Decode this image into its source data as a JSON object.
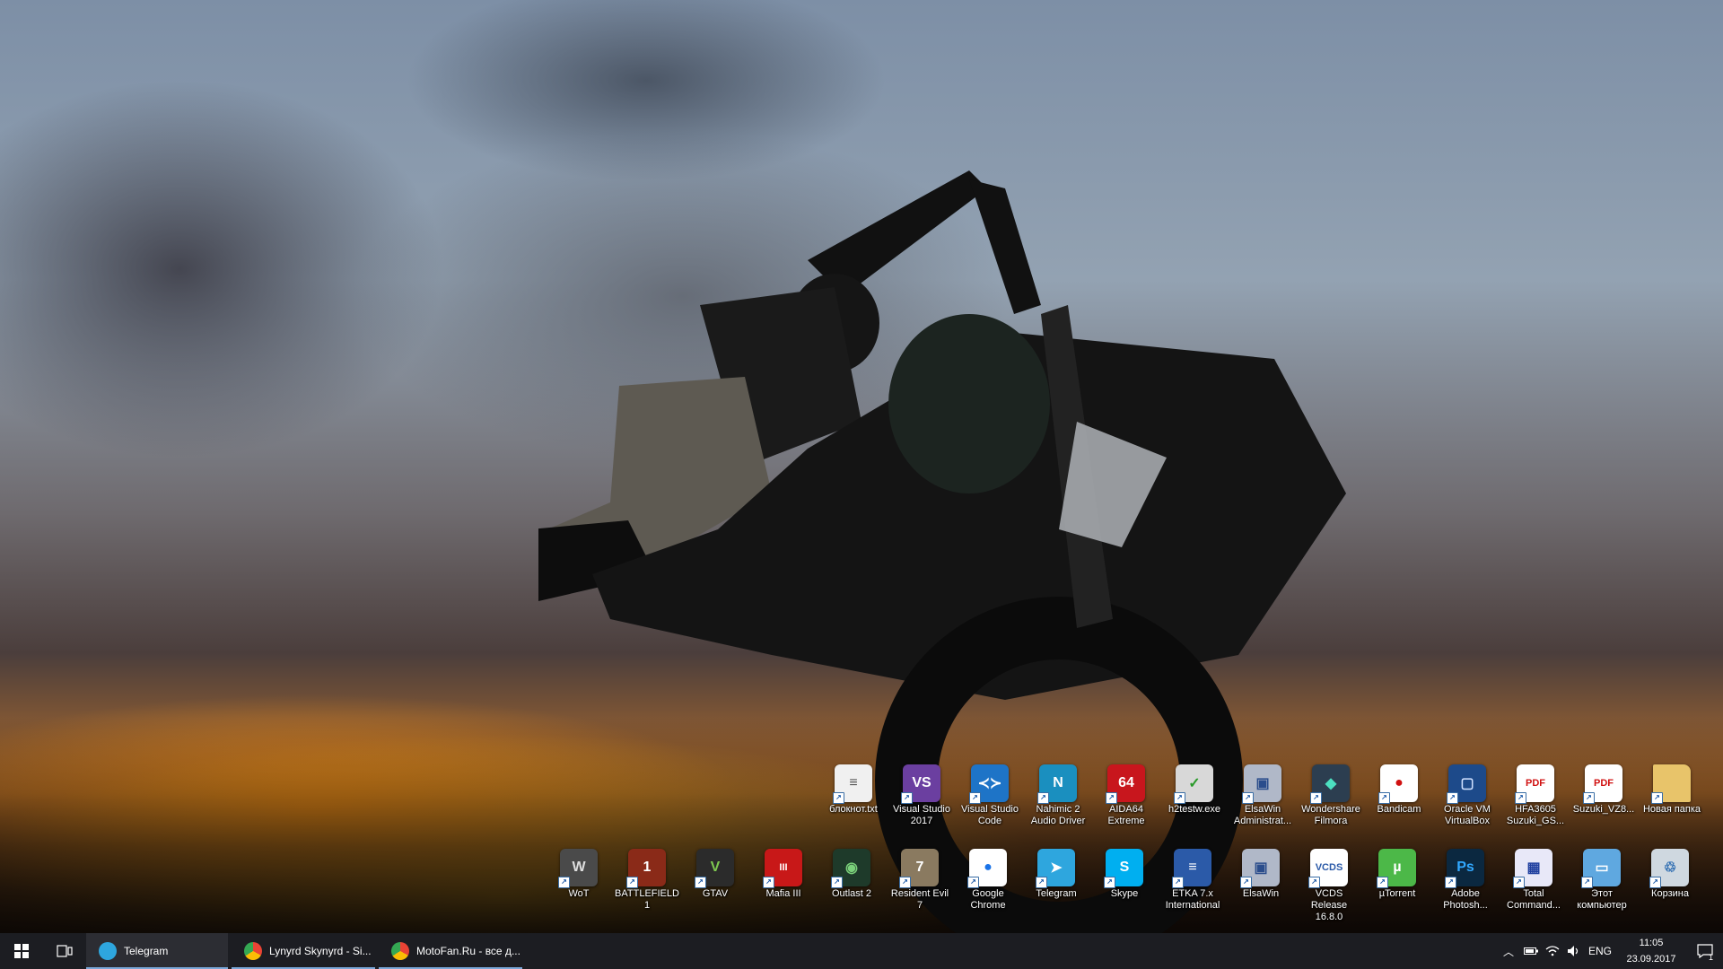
{
  "desktop_icons_row1": [
    {
      "label": "блокнот.txt",
      "icon": "text-file-icon",
      "color": "#f0f0f0",
      "glyph": "≡",
      "fg": "#555"
    },
    {
      "label": "Visual Studio 2017",
      "icon": "visual-studio-icon",
      "color": "#6b3fa0",
      "glyph": "VS",
      "fg": "#fff"
    },
    {
      "label": "Visual Studio Code",
      "icon": "vscode-icon",
      "color": "#1e74c7",
      "glyph": "≺≻",
      "fg": "#fff"
    },
    {
      "label": "Nahimic 2 Audio Driver",
      "icon": "nahimic-icon",
      "color": "#1a8fbf",
      "glyph": "N",
      "fg": "#fff"
    },
    {
      "label": "AIDA64 Extreme",
      "icon": "aida64-icon",
      "color": "#c8161d",
      "glyph": "64",
      "fg": "#fff"
    },
    {
      "label": "h2testw.exe",
      "icon": "h2testw-icon",
      "color": "#d8d8d8",
      "glyph": "✓",
      "fg": "#2a9a2a"
    },
    {
      "label": "ElsaWin Administrat...",
      "icon": "elsawin-admin-icon",
      "color": "#b0b8c8",
      "glyph": "▣",
      "fg": "#2b4d8c"
    },
    {
      "label": "Wondershare Filmora",
      "icon": "filmora-icon",
      "color": "#2c3e50",
      "glyph": "◆",
      "fg": "#4ce0c0"
    },
    {
      "label": "Bandicam",
      "icon": "bandicam-icon",
      "color": "#ffffff",
      "glyph": "●",
      "fg": "#d01010"
    },
    {
      "label": "Oracle VM VirtualBox",
      "icon": "virtualbox-icon",
      "color": "#1d4a8a",
      "glyph": "▢",
      "fg": "#cfe0ff"
    },
    {
      "label": "HFA3605 Suzuki_GS...",
      "icon": "pdf-icon",
      "color": "#ffffff",
      "glyph": "PDF",
      "fg": "#d01010"
    },
    {
      "label": "Suzuki_VZ8...",
      "icon": "pdf-icon",
      "color": "#ffffff",
      "glyph": "PDF",
      "fg": "#d01010"
    },
    {
      "label": "Новая папка",
      "icon": "folder-icon",
      "color": "#e8c46a",
      "glyph": "",
      "fg": "#fff"
    }
  ],
  "desktop_icons_row2": [
    {
      "label": "WoT",
      "icon": "world-of-tanks-icon",
      "color": "#4a4a4a",
      "glyph": "W",
      "fg": "#ddd"
    },
    {
      "label": "BATTLEFIELD 1",
      "icon": "battlefield-icon",
      "color": "#8a2a18",
      "glyph": "1",
      "fg": "#fff"
    },
    {
      "label": "GTAV",
      "icon": "gtav-icon",
      "color": "#2b2b2b",
      "glyph": "V",
      "fg": "#7ec850"
    },
    {
      "label": "Mafia III",
      "icon": "mafia-icon",
      "color": "#c81818",
      "glyph": "III",
      "fg": "#fff"
    },
    {
      "label": "Outlast 2",
      "icon": "outlast-icon",
      "color": "#1e3a2a",
      "glyph": "◉",
      "fg": "#7ad07a"
    },
    {
      "label": "Resident Evil 7",
      "icon": "resident-evil-icon",
      "color": "#8a7a60",
      "glyph": "7",
      "fg": "#fff"
    },
    {
      "label": "Google Chrome",
      "icon": "chrome-icon",
      "color": "#ffffff",
      "glyph": "●",
      "fg": "#1a73e8"
    },
    {
      "label": "Telegram",
      "icon": "telegram-icon",
      "color": "#2ea6de",
      "glyph": "➤",
      "fg": "#fff"
    },
    {
      "label": "Skype",
      "icon": "skype-icon",
      "color": "#00aff0",
      "glyph": "S",
      "fg": "#fff"
    },
    {
      "label": "ETKA 7.x International",
      "icon": "etka-icon",
      "color": "#2b5aa8",
      "glyph": "≡",
      "fg": "#fff"
    },
    {
      "label": "ElsaWin",
      "icon": "elsawin-icon",
      "color": "#b0b8c8",
      "glyph": "▣",
      "fg": "#2b4d8c"
    },
    {
      "label": "VCDS Release 16.8.0",
      "icon": "vcds-icon",
      "color": "#ffffff",
      "glyph": "VCDS",
      "fg": "#2b5aa8"
    },
    {
      "label": "µTorrent",
      "icon": "utorrent-icon",
      "color": "#4cb848",
      "glyph": "µ",
      "fg": "#fff"
    },
    {
      "label": "Adobe Photosh...",
      "icon": "photoshop-icon",
      "color": "#0b2840",
      "glyph": "Ps",
      "fg": "#31a8ff"
    },
    {
      "label": "Total Command...",
      "icon": "total-commander-icon",
      "color": "#e8e8f8",
      "glyph": "▦",
      "fg": "#2040a0"
    },
    {
      "label": "Этот компьютер",
      "icon": "this-pc-icon",
      "color": "#5fa8e0",
      "glyph": "▭",
      "fg": "#fff"
    },
    {
      "label": "Корзина",
      "icon": "recycle-bin-icon",
      "color": "#cfd8e0",
      "glyph": "♲",
      "fg": "#2a6ab0"
    }
  ],
  "taskbar": {
    "apps": [
      {
        "label": "Telegram",
        "icon": "telegram-icon",
        "color": "#2ea6de"
      },
      {
        "label": "Lynyrd Skynyrd - Si...",
        "icon": "chrome-icon",
        "color": "#e8453c"
      },
      {
        "label": "MotoFan.Ru - все д...",
        "icon": "chrome-icon",
        "color": "#e8453c"
      }
    ],
    "language": "ENG",
    "time": "11:05",
    "date": "23.09.2017",
    "notification_count": "1"
  }
}
